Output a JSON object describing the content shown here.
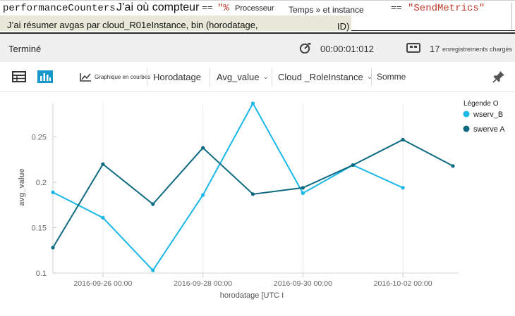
{
  "query": {
    "line1": {
      "table": "performanceCounters",
      "where_text": "J’ai où compteur",
      "op1": "==",
      "value1": "\"%",
      "value1_word": "Processeur",
      "and_text": "Temps » et instance",
      "op2": "==",
      "value2": "\"SendMetrics\""
    },
    "line2": {
      "summarize_text": "J’ai résumer avgas par cloud_R01eInstance, bin (horodatage,",
      "tail": "ID)"
    }
  },
  "status": {
    "state": "Terminé",
    "duration": "00:00:01:012",
    "record_count": "17",
    "records_label": "enregistrements chargés"
  },
  "toolbar": {
    "linechart_label": "Graphique en courbes",
    "x_field": "Horodatage",
    "y_field": "Avg_value",
    "split_field": "Cloud _RoleInstance",
    "agg_label": "Somme"
  },
  "colors": {
    "series_light": "#1ab8e8",
    "series_dark": "#0e6a80",
    "active_icon": "#1597c9",
    "string_red": "#c0392b"
  },
  "chart_data": {
    "type": "line",
    "xlabel": "horodatage [UTC I",
    "ylabel": "avg_value",
    "x_ticks": [
      "2016-09-26 00:00",
      "2016-09-28 00:00",
      "2016-09-30 00:00",
      "2016-10-02 00:00"
    ],
    "y_ticks": [
      "0.1",
      "0.15",
      "0.2",
      "0.25"
    ],
    "ylim": [
      0.1,
      0.29
    ],
    "legend_title": "Légende O",
    "legend_position": "top-right",
    "series": [
      {
        "name": "wserv_B",
        "color": "#1ab8e8",
        "points": [
          {
            "x": "2016-09-25 00:00",
            "y": 0.189
          },
          {
            "x": "2016-09-26 00:00",
            "y": 0.161
          },
          {
            "x": "2016-09-27 00:00",
            "y": 0.103
          },
          {
            "x": "2016-09-28 00:00",
            "y": 0.186
          },
          {
            "x": "2016-09-29 00:00",
            "y": 0.287
          },
          {
            "x": "2016-09-30 00:00",
            "y": 0.188
          },
          {
            "x": "2016-10-01 00:00",
            "y": 0.219
          },
          {
            "x": "2016-10-02 00:00",
            "y": 0.194
          }
        ]
      },
      {
        "name": "swerve A",
        "color": "#0e6a80",
        "points": [
          {
            "x": "2016-09-25 00:00",
            "y": 0.128
          },
          {
            "x": "2016-09-26 00:00",
            "y": 0.22
          },
          {
            "x": "2016-09-27 00:00",
            "y": 0.176
          },
          {
            "x": "2016-09-28 00:00",
            "y": 0.238
          },
          {
            "x": "2016-09-29 00:00",
            "y": 0.187
          },
          {
            "x": "2016-09-30 00:00",
            "y": 0.194
          },
          {
            "x": "2016-10-01 00:00",
            "y": 0.219
          },
          {
            "x": "2016-10-02 00:00",
            "y": 0.247
          },
          {
            "x": "2016-10-03 00:00",
            "y": 0.218
          }
        ]
      }
    ]
  }
}
